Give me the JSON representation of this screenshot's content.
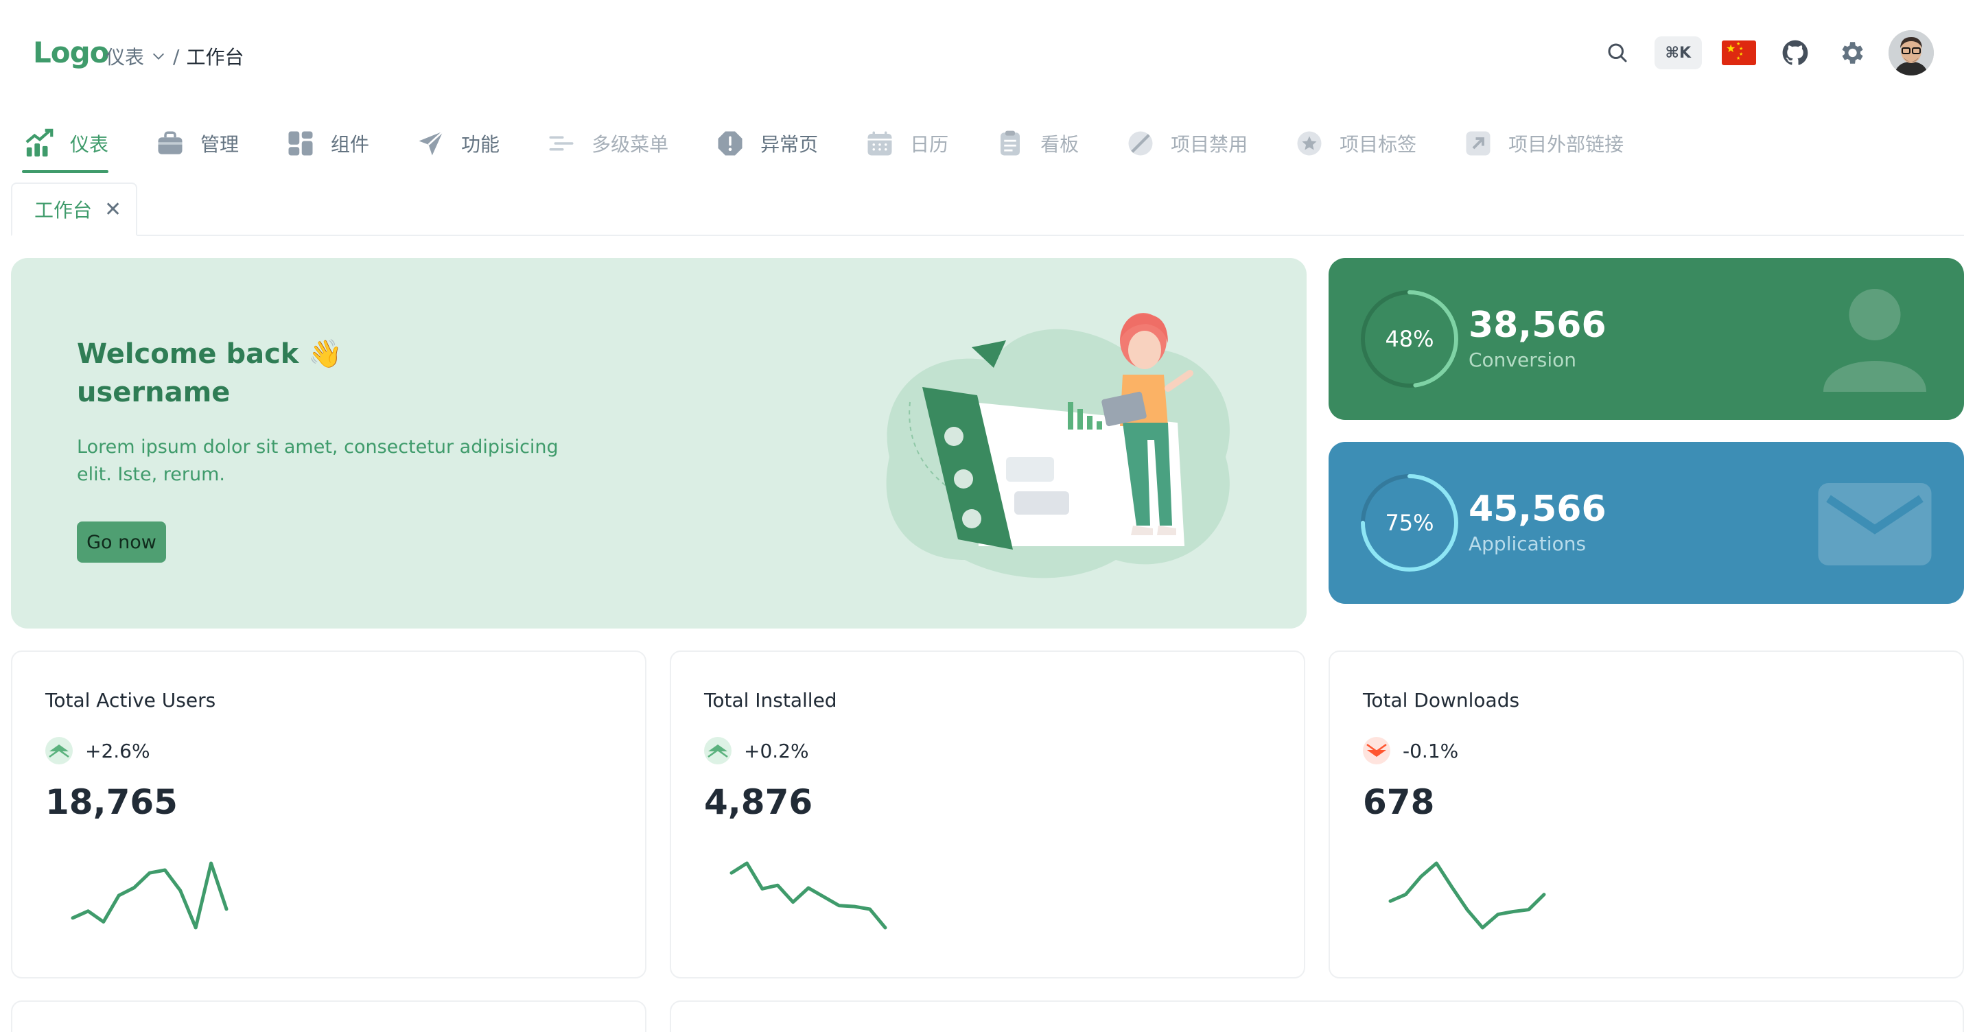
{
  "header": {
    "logo": "Logo",
    "breadcrumb": {
      "parent": "仪表",
      "current": "工作台"
    },
    "shortcut": "⌘K"
  },
  "nav": [
    {
      "label": "仪表",
      "icon": "chart-up-icon",
      "state": "active"
    },
    {
      "label": "管理",
      "icon": "briefcase-icon",
      "state": "normal"
    },
    {
      "label": "组件",
      "icon": "widgets-icon",
      "state": "normal"
    },
    {
      "label": "功能",
      "icon": "paper-plane-icon",
      "state": "normal"
    },
    {
      "label": "多级菜单",
      "icon": "menu-levels-icon",
      "state": "dim"
    },
    {
      "label": "异常页",
      "icon": "alert-icon",
      "state": "normal"
    },
    {
      "label": "日历",
      "icon": "calendar-icon",
      "state": "dim"
    },
    {
      "label": "看板",
      "icon": "clipboard-icon",
      "state": "dim"
    },
    {
      "label": "项目禁用",
      "icon": "disabled-icon",
      "state": "dim"
    },
    {
      "label": "项目标签",
      "icon": "star-icon",
      "state": "dim"
    },
    {
      "label": "项目外部链接",
      "icon": "external-link-icon",
      "state": "dim"
    }
  ],
  "tabs": [
    {
      "label": "工作台"
    }
  ],
  "welcome": {
    "line1": "Welcome back 👋",
    "line2": "username",
    "description": "Lorem ipsum dolor sit amet, consectetur adipisicing elit. Iste, rerum.",
    "button": "Go now"
  },
  "stats": [
    {
      "percent_label": "48%",
      "percent": 48,
      "value": "38,566",
      "label": "Conversion",
      "ring_color": "#7fd3a5",
      "track_color": "#2f7650"
    },
    {
      "percent_label": "75%",
      "percent": 75,
      "value": "45,566",
      "label": "Applications",
      "ring_color": "#8ee6f5",
      "track_color": "#347a9c"
    }
  ],
  "kpis": [
    {
      "title": "Total Active Users",
      "trend": "+2.6%",
      "direction": "up",
      "value": "18,765",
      "spark": [
        22,
        29,
        18,
        45,
        53,
        68,
        71,
        50,
        12,
        78,
        31
      ]
    },
    {
      "title": "Total Installed",
      "trend": "+0.2%",
      "direction": "up",
      "value": "4,876",
      "spark": [
        63,
        74,
        45,
        49,
        30,
        46,
        36,
        26,
        25,
        22,
        1
      ]
    },
    {
      "title": "Total Downloads",
      "trend": "-0.1%",
      "direction": "down",
      "value": "678",
      "spark": [
        40,
        47,
        66,
        80,
        55,
        31,
        12,
        26,
        29,
        31,
        47
      ]
    }
  ],
  "colors": {
    "primary": "#3f9b6b",
    "up": "#5bb27e",
    "down": "#ff5630"
  }
}
